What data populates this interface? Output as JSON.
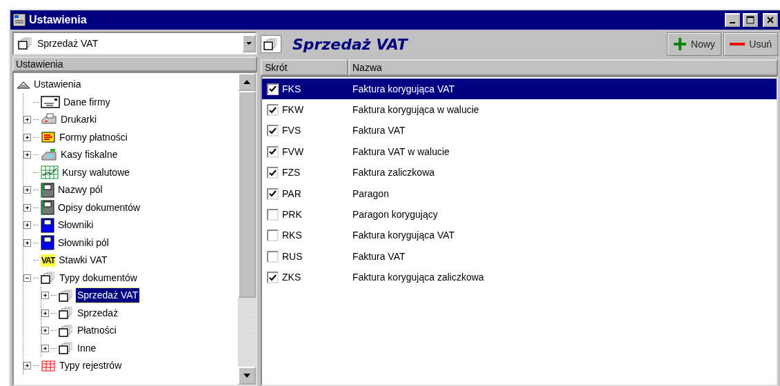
{
  "window": {
    "title": "Ustawienia"
  },
  "left_panel": {
    "combo_value": "Sprzedaż VAT",
    "header": "Ustawienia",
    "tree": [
      {
        "label": "Ustawienia",
        "kind": "root",
        "selected": false,
        "children": [
          {
            "label": "Dane firmy",
            "kind": "card",
            "selected": false
          },
          {
            "label": "Drukarki",
            "kind": "printer",
            "expanded": false,
            "selected": false
          },
          {
            "label": "Formy płatności",
            "kind": "payment",
            "expanded": false,
            "selected": false
          },
          {
            "label": "Kasy fiskalne",
            "kind": "register",
            "expanded": false,
            "selected": false
          },
          {
            "label": "Kursy walutowe",
            "kind": "grid",
            "selected": false
          },
          {
            "label": "Nazwy pól",
            "kind": "device",
            "expanded": false,
            "selected": false
          },
          {
            "label": "Opisy dokumentów",
            "kind": "device",
            "expanded": false,
            "selected": false
          },
          {
            "label": "Słowniki",
            "kind": "device-blue",
            "expanded": false,
            "selected": false
          },
          {
            "label": "Słowniki pól",
            "kind": "device-blue",
            "expanded": false,
            "selected": false
          },
          {
            "label": "Stawki VAT",
            "kind": "badge",
            "icon_text": "VAT",
            "selected": false
          },
          {
            "label": "Typy dokumentów",
            "kind": "folders",
            "expanded": true,
            "selected": false,
            "children": [
              {
                "label": "Sprzedaż VAT",
                "kind": "folders",
                "expanded": false,
                "selected": true
              },
              {
                "label": "Sprzedaż",
                "kind": "folders",
                "expanded": false,
                "selected": false
              },
              {
                "label": "Płatności",
                "kind": "folders",
                "expanded": false,
                "selected": false
              },
              {
                "label": "Inne",
                "kind": "folders",
                "expanded": false,
                "selected": false
              }
            ]
          },
          {
            "label": "Typy rejestrów",
            "kind": "table",
            "expanded": false,
            "selected": false
          }
        ]
      }
    ]
  },
  "right_panel": {
    "title": "Sprzedaż VAT",
    "buttons": [
      {
        "label": "Nowy",
        "kind": "add"
      },
      {
        "label": "Usuń",
        "kind": "remove"
      }
    ],
    "table": {
      "columns": [
        "Skrót",
        "Nazwa"
      ],
      "rows": [
        {
          "code": "FKS",
          "name": "Faktura korygująca VAT",
          "checked": true,
          "selected": true
        },
        {
          "code": "FKW",
          "name": "Faktura korygująca w walucie",
          "checked": true,
          "selected": false
        },
        {
          "code": "FVS",
          "name": "Faktura VAT",
          "checked": true,
          "selected": false
        },
        {
          "code": "FVW",
          "name": "Faktura VAT w walucie",
          "checked": true,
          "selected": false
        },
        {
          "code": "FZS",
          "name": "Faktura zaliczkowa",
          "checked": true,
          "selected": false
        },
        {
          "code": "PAR",
          "name": "Paragon",
          "checked": true,
          "selected": false
        },
        {
          "code": "PRK",
          "name": "Paragon korygujący",
          "checked": false,
          "selected": false
        },
        {
          "code": "RKS",
          "name": "Faktura korygująca VAT",
          "checked": false,
          "selected": false
        },
        {
          "code": "RUS",
          "name": "Faktura VAT",
          "checked": false,
          "selected": false
        },
        {
          "code": "ZKS",
          "name": "Faktura korygująca zaliczkowa",
          "checked": true,
          "selected": false
        }
      ]
    }
  }
}
